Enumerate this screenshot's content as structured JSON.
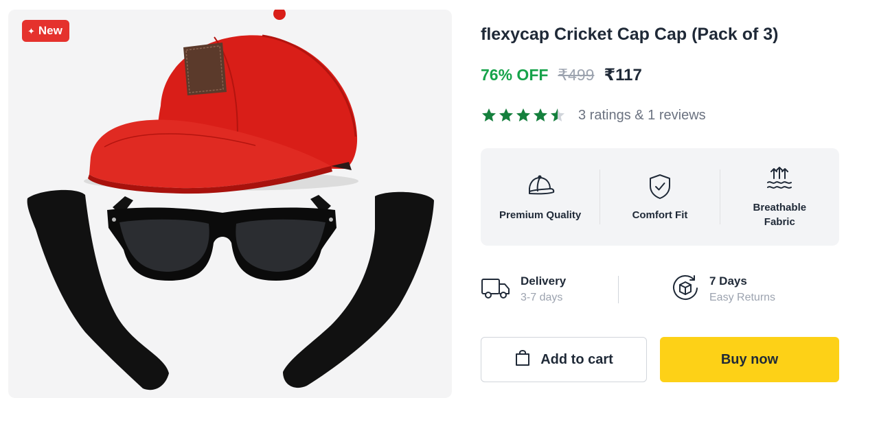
{
  "badge": {
    "label": "New"
  },
  "product": {
    "title": "flexycap Cricket Cap Cap (Pack of 3)",
    "discount": "76% OFF",
    "mrp": "₹499",
    "price": "₹117",
    "rating_value": 4.5,
    "rating_text": "3 ratings & 1 reviews"
  },
  "features": [
    {
      "icon": "cap-icon",
      "label": "Premium Quality"
    },
    {
      "icon": "shield-check-icon",
      "label": "Comfort Fit"
    },
    {
      "icon": "breathable-icon",
      "label": "Breathable Fabric"
    }
  ],
  "delivery": {
    "icon": "truck-icon",
    "title": "Delivery",
    "subtitle": "3-7 days"
  },
  "returns": {
    "icon": "return-box-icon",
    "title": "7 Days",
    "subtitle": "Easy Returns"
  },
  "actions": {
    "add_to_cart": "Add to cart",
    "buy_now": "Buy now"
  },
  "colors": {
    "discount": "#16a34a",
    "star": "#15803d",
    "badge": "#e5322d",
    "buy_button": "#fdd117"
  }
}
